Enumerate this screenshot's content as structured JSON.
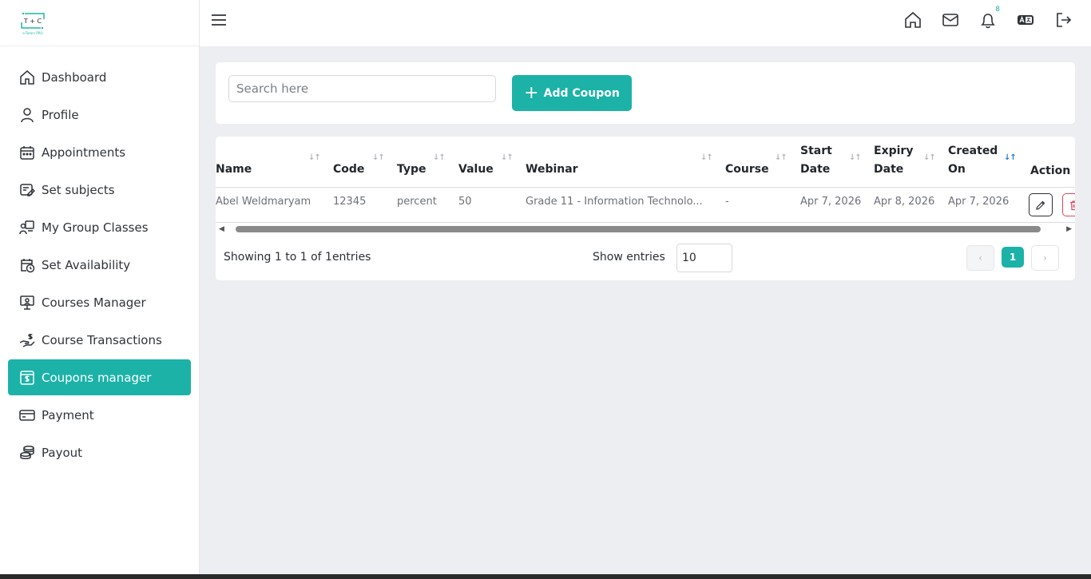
{
  "logo": {
    "text": "T + C",
    "sub": "e-Tutors PRO"
  },
  "sidebar": {
    "items": [
      {
        "label": "Dashboard",
        "icon": "home-icon",
        "active": false
      },
      {
        "label": "Profile",
        "icon": "user-icon",
        "active": false
      },
      {
        "label": "Appointments",
        "icon": "calendar-icon",
        "active": false
      },
      {
        "label": "Set subjects",
        "icon": "subjects-icon",
        "active": false
      },
      {
        "label": "My Group Classes",
        "icon": "group-classes-icon",
        "active": false
      },
      {
        "label": "Set Availability",
        "icon": "calendar-clock-icon",
        "active": false
      },
      {
        "label": "Courses Manager",
        "icon": "presentation-icon",
        "active": false
      },
      {
        "label": "Course Transactions",
        "icon": "hand-dollar-icon",
        "active": false
      },
      {
        "label": "Coupons manager",
        "icon": "coupon-icon",
        "active": true
      },
      {
        "label": "Payment",
        "icon": "credit-card-icon",
        "active": false
      },
      {
        "label": "Payout",
        "icon": "coins-icon",
        "active": false
      }
    ]
  },
  "topbar": {
    "notification_count": "8",
    "icons": [
      "home-icon",
      "mail-icon",
      "bell-icon",
      "language-icon",
      "logout-icon"
    ]
  },
  "search": {
    "placeholder": "Search here"
  },
  "add_button": {
    "label": "Add Coupon"
  },
  "table": {
    "headers": {
      "name": "Name",
      "code": "Code",
      "type": "Type",
      "value": "Value",
      "webinar": "Webinar",
      "course": "Course",
      "start_date_1": "Start",
      "start_date_2": "Date",
      "expiry_date_1": "Expiry",
      "expiry_date_2": "Date",
      "created_on_1": "Created",
      "created_on_2": "On",
      "action": "Action"
    },
    "rows": [
      {
        "name": "Abel Weldmaryam",
        "code": "12345",
        "type": "percent",
        "value": "50",
        "webinar": "Grade 11 - Information Technolo...",
        "course": "-",
        "start_date": "Apr 7, 2026",
        "expiry_date": "Apr 8, 2026",
        "created_on": "Apr 7, 2026"
      }
    ]
  },
  "footer": {
    "info": "Showing 1 to 1 of 1entries",
    "show_entries_label": "Show entries",
    "entries_value": "10",
    "current_page": "1"
  },
  "colors": {
    "accent": "#1cb2a8",
    "danger": "#e0485a",
    "background": "#eceef2"
  }
}
